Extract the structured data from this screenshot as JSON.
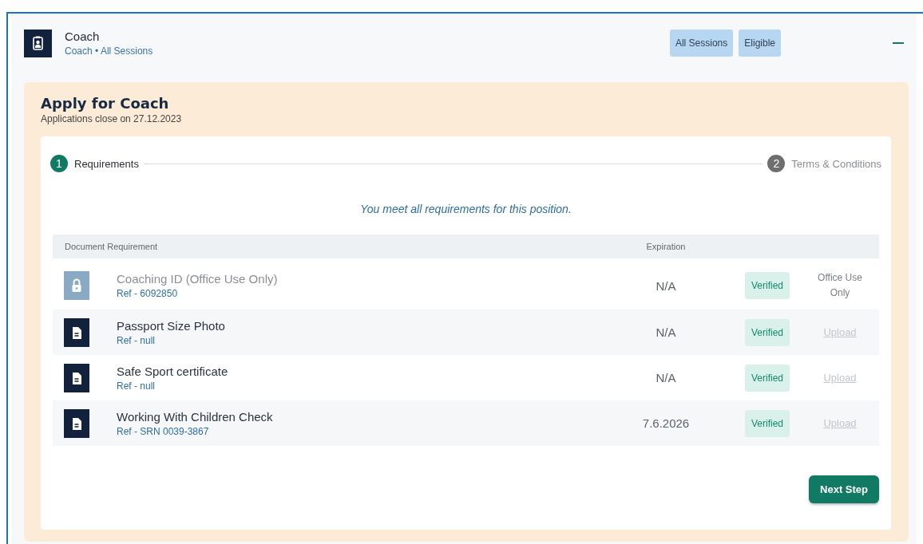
{
  "header": {
    "title": "Coach",
    "subtitle": "Coach • All Sessions",
    "tags": [
      "All Sessions",
      "Eligible"
    ]
  },
  "application": {
    "title": "Apply for Coach",
    "subtitle": "Applications close on 27.12.2023",
    "steps": [
      {
        "number": "1",
        "label": "Requirements",
        "selected": true
      },
      {
        "number": "2",
        "label": "Terms & Conditions",
        "selected": false
      }
    ],
    "message": "You meet all requirements for this position.",
    "columns": [
      "Document Requirement",
      "Expiration"
    ],
    "rows": [
      {
        "kind": "locked",
        "name": "Coaching ID (Office Use Only)",
        "ref": "Ref - 6092850",
        "expiration": "N/A",
        "status": "Verified",
        "action": "Office Use Only"
      },
      {
        "kind": "document",
        "name": "Passport Size Photo",
        "ref": "Ref - null",
        "expiration": "N/A",
        "status": "Verified",
        "action": "Upload",
        "disabled": true
      },
      {
        "kind": "document",
        "name": "Safe Sport certificate",
        "ref": "Ref - null",
        "expiration": "N/A",
        "status": "Verified",
        "action": "Upload",
        "disabled": true
      },
      {
        "kind": "document",
        "name": "Working With Children Check",
        "ref": "Ref - SRN 0039-3867",
        "expiration": "7.6.2026",
        "status": "Verified",
        "action": "Upload",
        "disabled": true
      }
    ],
    "next_button": "Next Step"
  }
}
